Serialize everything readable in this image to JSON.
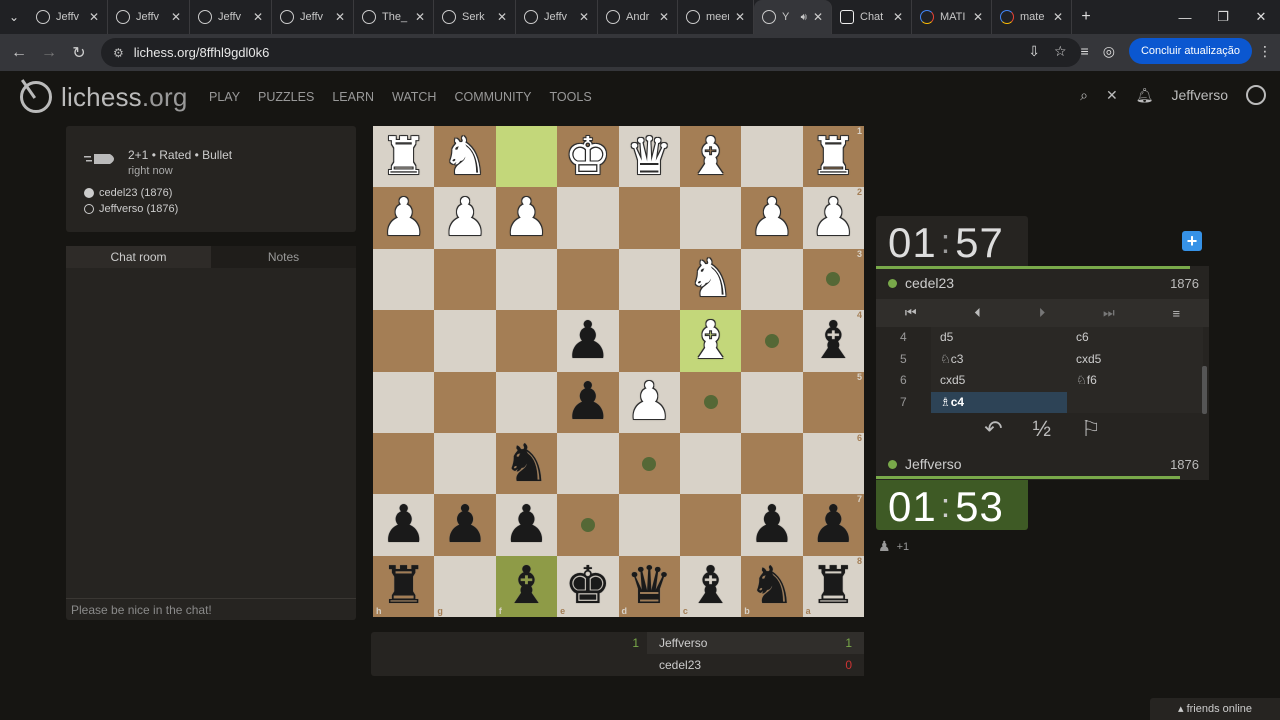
{
  "browser": {
    "tabs": [
      {
        "label": "Jeffv",
        "fav": "lichess"
      },
      {
        "label": "Jeffv",
        "fav": "lichess"
      },
      {
        "label": "Jeffv",
        "fav": "lichess"
      },
      {
        "label": "Jeffv",
        "fav": "lichess"
      },
      {
        "label": "The_",
        "fav": "lichess"
      },
      {
        "label": "Serk",
        "fav": "lichess"
      },
      {
        "label": "Jeffv",
        "fav": "lichess"
      },
      {
        "label": "Andr",
        "fav": "lichess"
      },
      {
        "label": "meer",
        "fav": "lichess"
      },
      {
        "label": "Y",
        "fav": "lichess"
      },
      {
        "label": "Chat",
        "fav": "chatgpt"
      },
      {
        "label": "MATI",
        "fav": "google"
      },
      {
        "label": "mate",
        "fav": "google"
      }
    ],
    "url": "lichess.org/8ffhl9gdl0k6",
    "update_label": "Concluir atualização"
  },
  "site": {
    "logo_main": "lichess",
    "logo_org": ".org",
    "nav": [
      "PLAY",
      "PUZZLES",
      "LEARN",
      "WATCH",
      "COMMUNITY",
      "TOOLS"
    ],
    "username": "Jeffverso"
  },
  "game_info": {
    "title": "2+1 • Rated • Bullet",
    "time": "right now",
    "white_player": "cedel23 (1876)",
    "black_player": "Jeffverso (1876)"
  },
  "chat": {
    "tab_chat": "Chat room",
    "tab_notes": "Notes",
    "placeholder": "Please be nice in the chat!"
  },
  "board": {
    "orientation": "black",
    "ranks": [
      "1",
      "2",
      "3",
      "4",
      "5",
      "6",
      "7",
      "8"
    ],
    "files": [
      "h",
      "g",
      "f",
      "e",
      "d",
      "c",
      "b",
      "a"
    ],
    "rows": [
      [
        "wR",
        "wN",
        "",
        "wK",
        "wQ",
        "wB",
        "",
        "wR"
      ],
      [
        "wP",
        "wP",
        "wP",
        "",
        "",
        "",
        "wP",
        "wP"
      ],
      [
        "",
        "",
        "",
        "",
        "",
        "wN",
        "",
        ""
      ],
      [
        "",
        "",
        "",
        "bP",
        "",
        "wB",
        "",
        "bB"
      ],
      [
        "",
        "",
        "",
        "bP",
        "wP",
        "",
        "",
        ""
      ],
      [
        "",
        "",
        "bN",
        "",
        "",
        "",
        "",
        ""
      ],
      [
        "bP",
        "bP",
        "bP",
        "",
        "",
        "",
        "bP",
        "bP"
      ],
      [
        "bR",
        "",
        "bB",
        "bK",
        "bQ",
        "bB",
        "bN",
        "bR"
      ]
    ]
  },
  "clocks": {
    "top": {
      "min": "01",
      "sec": "57"
    },
    "bottom": {
      "min": "01",
      "sec": "53"
    }
  },
  "players": {
    "top": {
      "name": "cedel23",
      "rating": "1876"
    },
    "bottom": {
      "name": "Jeffverso",
      "rating": "1876"
    }
  },
  "moves": [
    {
      "n": "4",
      "w": "d5",
      "b": "c6"
    },
    {
      "n": "5",
      "w": "♘c3",
      "b": "cxd5"
    },
    {
      "n": "6",
      "w": "cxd5",
      "b": "♘f6"
    },
    {
      "n": "7",
      "w": "♗c4",
      "b": ""
    }
  ],
  "actions": {
    "takeback": "↶",
    "draw": "½",
    "resign": "⚐"
  },
  "spectators": "+1",
  "score_table": {
    "left_score": "1",
    "row1": {
      "name": "Jeffverso",
      "score": "1"
    },
    "row2": {
      "name": "cedel23",
      "score": "0"
    }
  },
  "friends_label": "friends online",
  "colors": {
    "accent_green": "#79a94a",
    "loss_red": "#cc3333",
    "clock_active": "#3e5a25",
    "blue": "#3692e7"
  }
}
